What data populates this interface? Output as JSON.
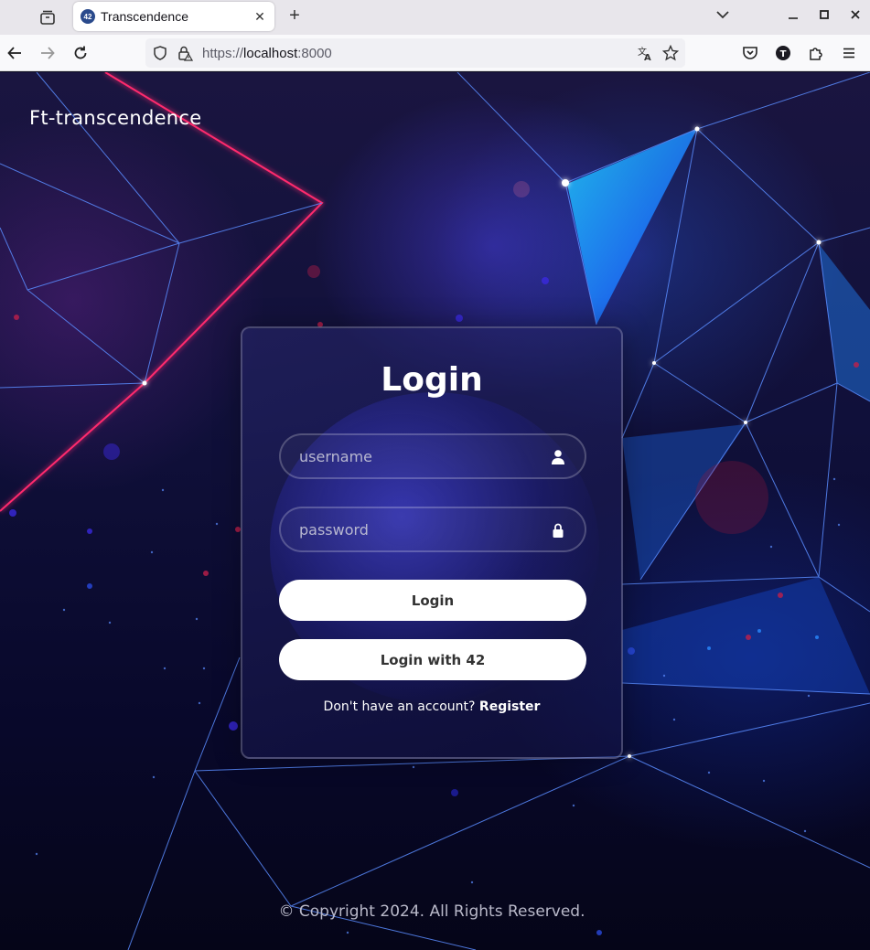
{
  "browser": {
    "tab_title": "Transcendence",
    "tab_favicon_text": "42",
    "url_scheme": "https://",
    "url_host": "localhost",
    "url_port": ":8000"
  },
  "page": {
    "brand": "Ft-transcendence",
    "login": {
      "title": "Login",
      "username_placeholder": "username",
      "password_placeholder": "password",
      "login_button": "Login",
      "login42_button": "Login with 42",
      "no_account_text": "Don't have an account?",
      "register_link": "Register"
    },
    "footer": {
      "copyright": "© Copyright 2024. All Rights Reserved."
    }
  },
  "icons": {
    "username_field": "user-icon",
    "password_field": "lock-icon"
  },
  "colors": {
    "button_bg": "#ffffff",
    "button_text": "#333333",
    "accent_red": "#ff2a6d",
    "accent_blue": "#3a7bff"
  }
}
